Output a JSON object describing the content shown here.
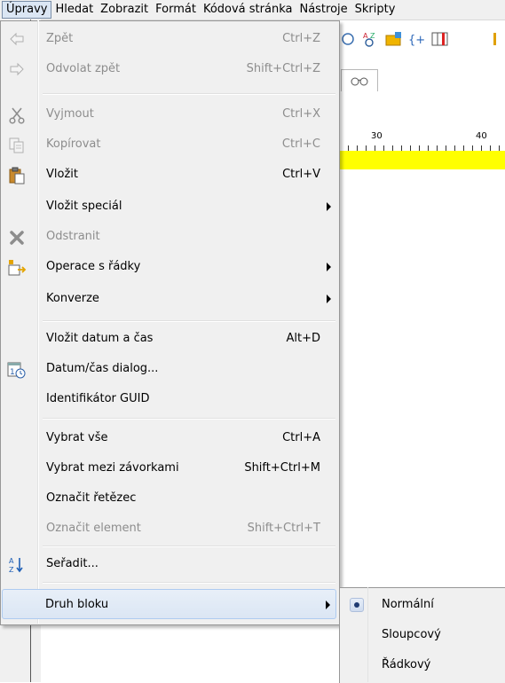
{
  "menubar": [
    {
      "label": "Úpravy",
      "active": true
    },
    {
      "label": "Hledat"
    },
    {
      "label": "Zobrazit"
    },
    {
      "label": "Formát"
    },
    {
      "label": "Kódová stránka"
    },
    {
      "label": "Nástroje"
    },
    {
      "label": "Skripty"
    }
  ],
  "editor": {
    "ruler_30": "30",
    "ruler_40": "40",
    "highlight_color": "#ffff00"
  },
  "menu": {
    "items": [
      {
        "label": "Zpět",
        "shortcut": "Ctrl+Z",
        "icon": "undo-icon",
        "disabled": true
      },
      {
        "label": "Odvolat zpět",
        "shortcut": "Shift+Ctrl+Z",
        "icon": "redo-icon",
        "disabled": true
      },
      {
        "label": "Vyjmout",
        "shortcut": "Ctrl+X",
        "icon": "scissors-icon",
        "disabled": true
      },
      {
        "label": "Kopírovat",
        "shortcut": "Ctrl+C",
        "icon": "copy-icon",
        "disabled": true
      },
      {
        "label": "Vložit",
        "shortcut": "Ctrl+V",
        "icon": "paste-icon"
      },
      {
        "label": "Vložit speciál",
        "submenu": true
      },
      {
        "label": "Odstranit",
        "icon": "delete-icon",
        "disabled": true
      },
      {
        "label": "Operace s řádky",
        "icon": "line-operations-icon",
        "submenu": true
      },
      {
        "label": "Konverze",
        "submenu": true
      },
      {
        "label": "Vložit datum a čas",
        "shortcut": "Alt+D"
      },
      {
        "label": "Datum/čas dialog...",
        "icon": "calendar-clock-icon"
      },
      {
        "label": "Identifikátor GUID"
      },
      {
        "label": "Vybrat vše",
        "shortcut": "Ctrl+A"
      },
      {
        "label": "Vybrat mezi závorkami",
        "shortcut": "Shift+Ctrl+M"
      },
      {
        "label": "Označit řetězec"
      },
      {
        "label": "Označit element",
        "shortcut": "Shift+Ctrl+T",
        "disabled": true
      },
      {
        "label": "Seřadit...",
        "icon": "sort-az-icon"
      },
      {
        "label": "Druh bloku",
        "submenu": true,
        "highlighted": true
      }
    ]
  },
  "submenu": {
    "items": [
      {
        "label": "Normální",
        "checked": true
      },
      {
        "label": "Sloupcový"
      },
      {
        "label": "Řádkový"
      }
    ]
  }
}
